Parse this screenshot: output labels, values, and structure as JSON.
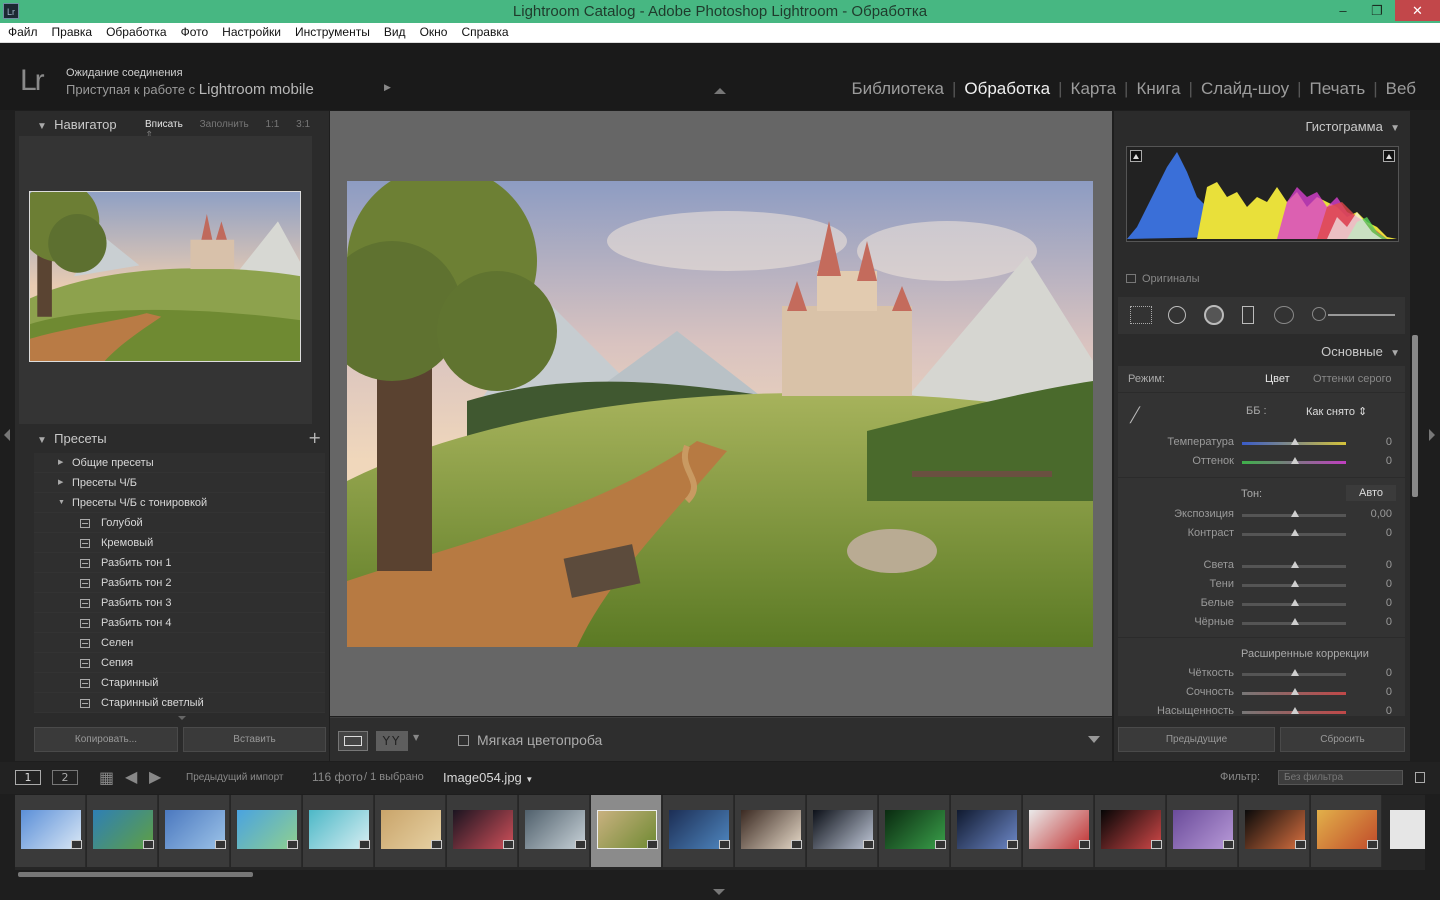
{
  "window": {
    "title": "Lightroom Catalog - Adobe Photoshop Lightroom - Обработка",
    "app_icon": "Lr"
  },
  "menu": [
    "Файл",
    "Правка",
    "Обработка",
    "Фото",
    "Настройки",
    "Инструменты",
    "Вид",
    "Окно",
    "Справка"
  ],
  "identity": {
    "logo": "Lr",
    "line1": "Ожидание соединения",
    "line2_prefix": "Приступая к работе с",
    "line2_brand": "Lightroom mobile"
  },
  "modules": [
    {
      "label": "Библиотека",
      "active": false
    },
    {
      "label": "Обработка",
      "active": true
    },
    {
      "label": "Карта",
      "active": false
    },
    {
      "label": "Книга",
      "active": false
    },
    {
      "label": "Слайд-шоу",
      "active": false
    },
    {
      "label": "Печать",
      "active": false
    },
    {
      "label": "Веб",
      "active": false
    }
  ],
  "navigator": {
    "title": "Навигатор",
    "opts": [
      "Вписать",
      "Заполнить",
      "1:1",
      "3:1"
    ]
  },
  "presets": {
    "title": "Пресеты",
    "folders": [
      "Общие пресеты",
      "Пресеты Ч/Б",
      "Пресеты Ч/Б с тонировкой"
    ],
    "items": [
      "Голубой",
      "Кремовый",
      "Разбить тон 1",
      "Разбить тон 2",
      "Разбить тон 3",
      "Разбить тон 4",
      "Селен",
      "Сепия",
      "Старинный",
      "Старинный светлый"
    ]
  },
  "left_buttons": {
    "copy": "Копировать...",
    "paste": "Вставить"
  },
  "toolbar": {
    "softproof": "Мягкая цветопроба"
  },
  "right": {
    "histogram": "Гистограмма",
    "originals": "Оригиналы",
    "basic": "Основные",
    "mode_label": "Режим:",
    "mode_color": "Цвет",
    "mode_gray": "Оттенки серого",
    "wb_label": "ББ :",
    "wb_value": "Как снято",
    "tone_label": "Тон:",
    "auto": "Авто",
    "advanced": "Расширенные коррекции",
    "sliders": [
      {
        "label": "Температура",
        "value": "0"
      },
      {
        "label": "Оттенок",
        "value": "0"
      },
      {
        "label": "Экспозиция",
        "value": "0,00"
      },
      {
        "label": "Контраст",
        "value": "0"
      },
      {
        "label": "Света",
        "value": "0"
      },
      {
        "label": "Тени",
        "value": "0"
      },
      {
        "label": "Белые",
        "value": "0"
      },
      {
        "label": "Чёрные",
        "value": "0"
      },
      {
        "label": "Чёткость",
        "value": "0"
      },
      {
        "label": "Сочность",
        "value": "0"
      },
      {
        "label": "Насыщенность",
        "value": "0"
      }
    ],
    "prev": "Предыдущие",
    "reset": "Сбросить"
  },
  "filmstrip": {
    "screen1": "1",
    "screen2": "2",
    "source": "Предыдущий импорт",
    "count": "116 фото",
    "selected": "/ 1 выбрано",
    "filename": "Image054.jpg",
    "filter_label": "Фильтр:",
    "filter_value": "Без фильтра"
  },
  "colors": {
    "title_green": "#47b782",
    "panel": "#2b2b2b",
    "centre": "#666666"
  }
}
